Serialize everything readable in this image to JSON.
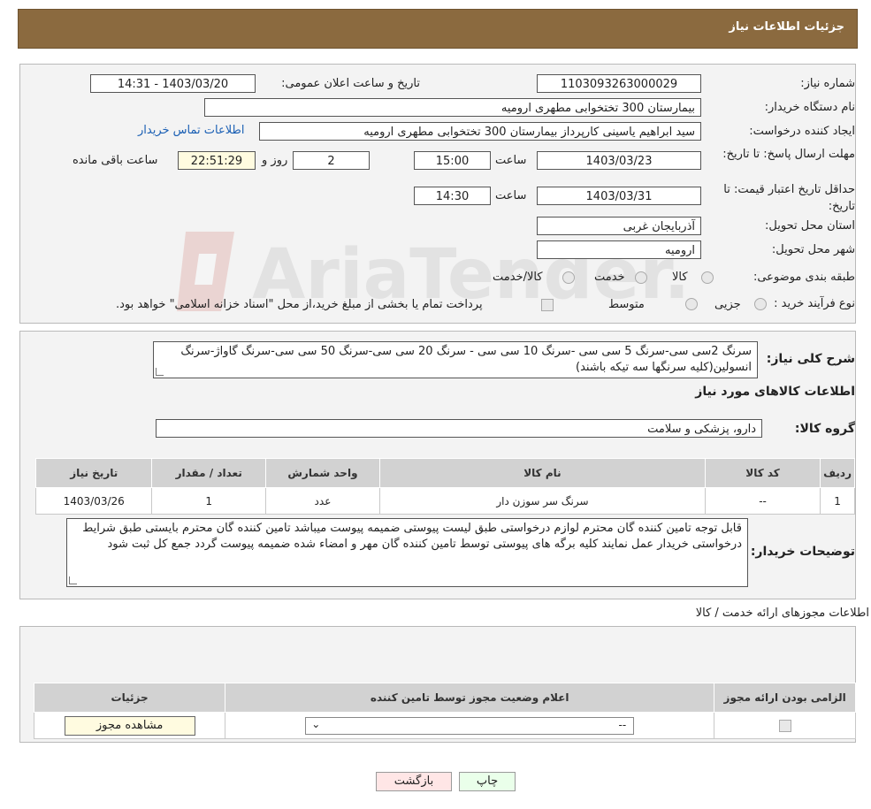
{
  "header": {
    "title": "جزئیات اطلاعات نیاز"
  },
  "watermark": {
    "text": "AriaTender.neT"
  },
  "info": {
    "need_number_label": "شماره نیاز:",
    "need_number": "1103093263000029",
    "announce_label": "تاریخ و ساعت اعلان عمومی:",
    "announce_value": "1403/03/20 - 14:31",
    "buyer_org_label": "نام دستگاه خریدار:",
    "buyer_org": "بیمارستان 300 تختخوابی مطهری  ارومیه",
    "requester_label": "ایجاد کننده درخواست:",
    "requester": "سید ابراهیم یاسینی کارپرداز بیمارستان 300 تختخوابی مطهری  ارومیه",
    "contact_link": "اطلاعات تماس خریدار",
    "reply_deadline_label": "مهلت ارسال پاسخ: تا تاریخ:",
    "reply_date": "1403/03/23",
    "time_label": "ساعت",
    "reply_time": "15:00",
    "days_value": "2",
    "days_label": "روز و",
    "remaining_time": "22:51:29",
    "remaining_label": "ساعت باقی مانده",
    "price_validity_label": "حداقل تاریخ اعتبار قیمت: تا تاریخ:",
    "validity_date": "1403/03/31",
    "validity_time": "14:30",
    "province_label": "استان محل تحویل:",
    "province": "آذربایجان غربی",
    "city_label": "شهر محل تحویل:",
    "city": "ارومیه",
    "category_label": "طبقه بندی موضوعی:",
    "category_options": [
      "کالا",
      "خدمت",
      "کالا/خدمت"
    ],
    "process_label": "نوع فرآیند خرید :",
    "process_options": [
      "جزیی",
      "متوسط"
    ],
    "process_note": "پرداخت تمام یا بخشی از مبلغ خرید،از محل \"اسناد خزانه اسلامی\" خواهد بود."
  },
  "details": {
    "summary_label": "شرح کلی نیاز:",
    "summary_text": "سرنگ 2سی سی-سرنگ 5 سی سی -سرنگ 10 سی سی - سرنگ 20 سی سی-سرنگ 50 سی سی-سرنگ گاواژ-سرنگ انسولین(کلیه سرنگها سه تیکه باشند)",
    "goods_info_title": "اطلاعات کالاهای مورد نیاز",
    "goods_group_label": "گروه کالا:",
    "goods_group": "دارو، پزشکی و سلامت",
    "table_headers": [
      "ردیف",
      "کد کالا",
      "نام کالا",
      "واحد شمارش",
      "تعداد / مقدار",
      "تاریخ نیاز"
    ],
    "table_rows": [
      {
        "row": "1",
        "code": "--",
        "name": "سرنگ سر سوزن دار",
        "unit": "عدد",
        "qty": "1",
        "date": "1403/03/26"
      }
    ],
    "buyer_notes_label": "توضیحات خریدار:",
    "buyer_notes": "قابل توجه تامین کننده گان محترم لوازم درخواستی طبق لیست پیوستی ضمیمه پیوست میباشد تامین کننده گان محترم بایستی طبق شرایط درخواستی خریدار عمل نمایند کلیه برگه های پیوستی توسط تامین کننده گان مهر و امضاء شده ضمیمه پیوست گردد جمع کل ثبت شود"
  },
  "licenses": {
    "title": "اطلاعات مجوزهای ارائه خدمت / کالا",
    "headers": [
      "الزامی بودن ارائه مجوز",
      "اعلام وضعیت مجوز توسط تامین کننده",
      "جزئیات"
    ],
    "select_value": "--",
    "view_button": "مشاهده مجوز"
  },
  "footer": {
    "print_button": "چاپ",
    "back_button": "بازگشت"
  }
}
